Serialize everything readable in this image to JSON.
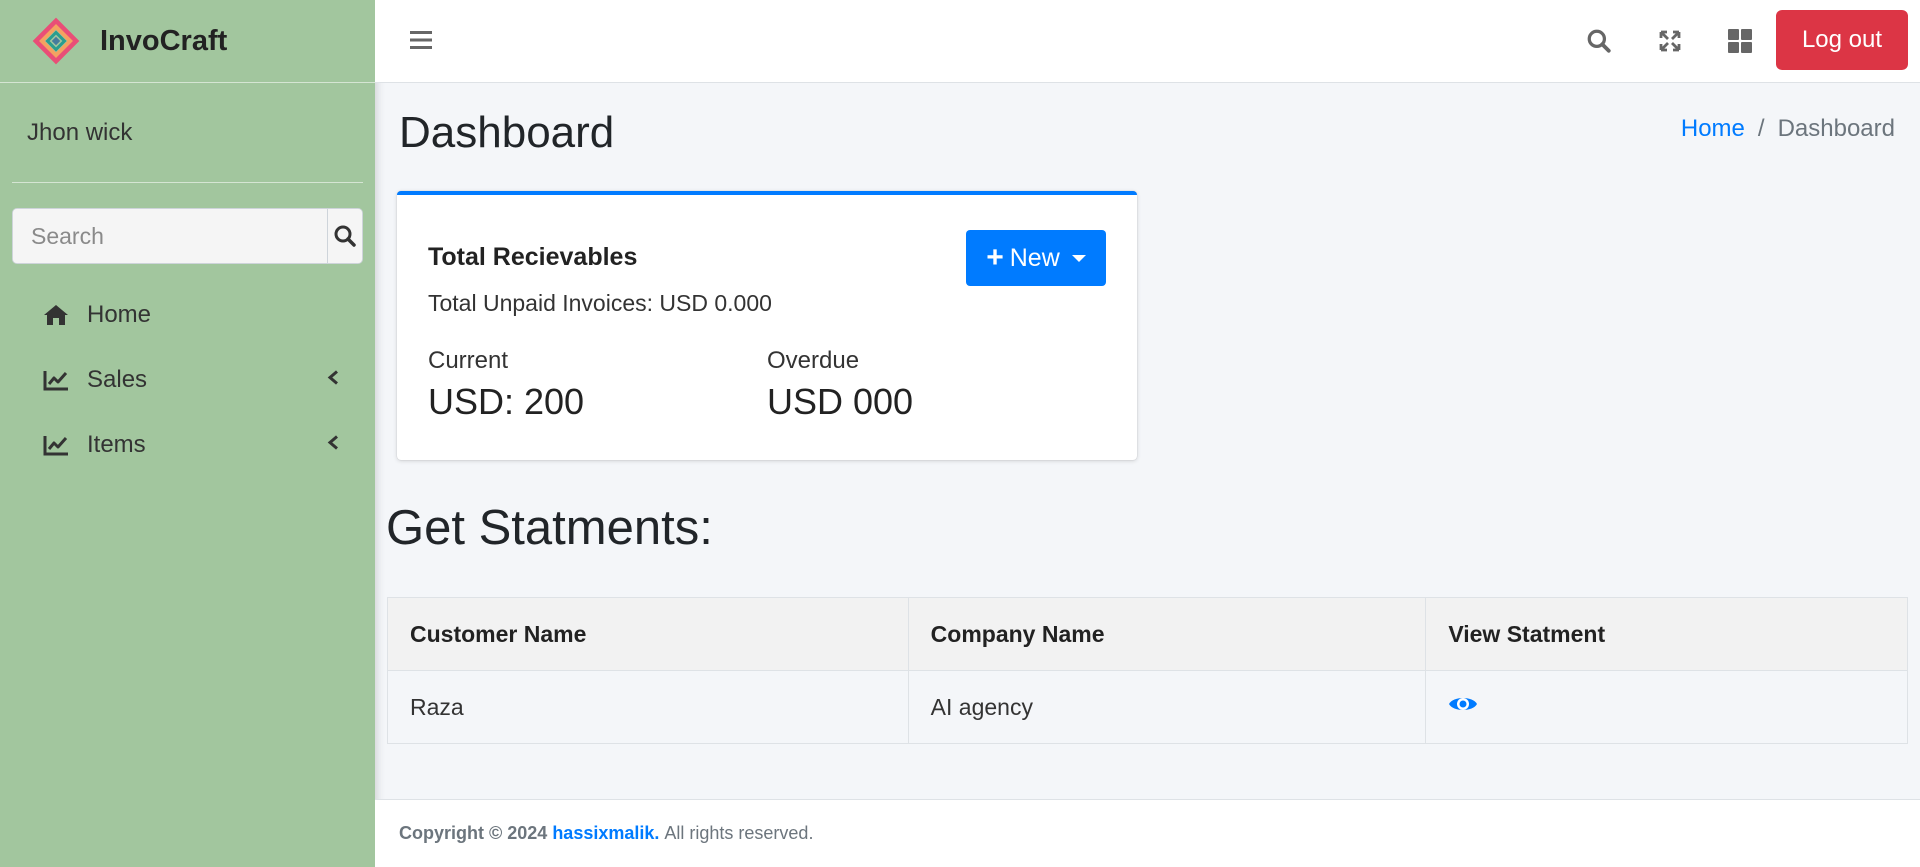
{
  "brand": {
    "title": "InvoCraft"
  },
  "user": {
    "name": "Jhon wick"
  },
  "sidebar": {
    "search_placeholder": "Search",
    "items": [
      {
        "label": "Home",
        "icon": "home-icon"
      },
      {
        "label": "Sales",
        "icon": "chart-line-icon"
      },
      {
        "label": "Items",
        "icon": "chart-line-icon"
      }
    ]
  },
  "topbar": {
    "logout_label": "Log out"
  },
  "page": {
    "title": "Dashboard"
  },
  "breadcrumb": {
    "home": "Home",
    "separator": "/",
    "current": "Dashboard"
  },
  "receivables": {
    "title": "Total Recievables",
    "unpaid": "Total Unpaid Invoices: USD 0.000",
    "new_label": "New",
    "current_label": "Current",
    "current_value": "USD: 200",
    "overdue_label": "Overdue",
    "overdue_value": "USD 000"
  },
  "statements": {
    "title": "Get Statments:",
    "headers": [
      "Customer Name",
      "Company Name",
      "View Statment"
    ],
    "rows": [
      {
        "customer": "Raza",
        "company": "AI agency"
      }
    ]
  },
  "footer": {
    "prefix": "Copyright © 2024",
    "owner": "hassixmalik.",
    "suffix": "All rights reserved."
  },
  "colors": {
    "sidebar": "#a2c69e",
    "primary": "#007bff",
    "danger": "#dc3545"
  }
}
